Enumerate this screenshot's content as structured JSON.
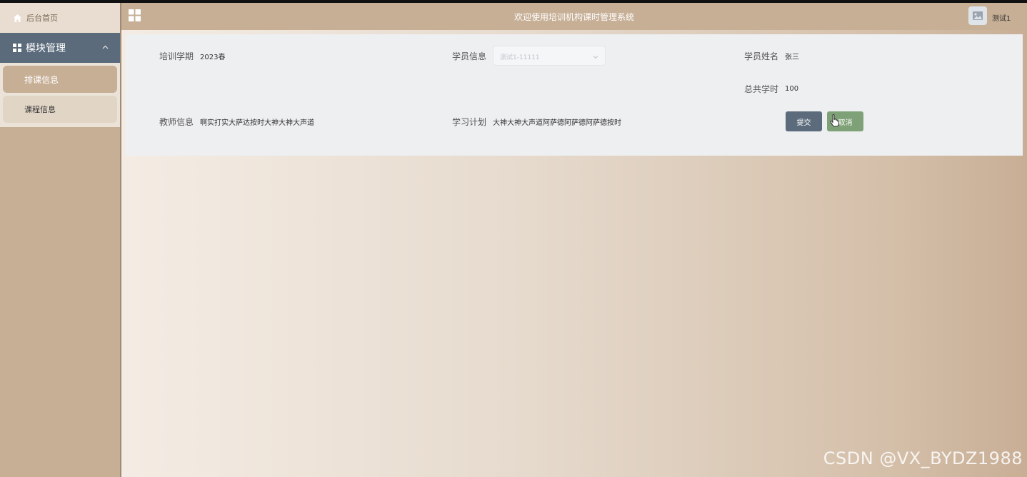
{
  "sidebar": {
    "home_label": "后台首页",
    "section_title": "模块管理",
    "items": [
      {
        "label": "排课信息",
        "active": true
      },
      {
        "label": "课程信息",
        "active": false
      }
    ]
  },
  "header": {
    "title": "欢迎使用培训机构课时管理系统",
    "username": "测试1"
  },
  "form": {
    "term_label": "培训学期",
    "term_value": "2023春",
    "student_info_label": "学员信息",
    "student_info_value": "测试1-11111",
    "student_name_label": "学员姓名",
    "student_name_value": "张三",
    "total_hours_label": "总共学时",
    "total_hours_value": "100",
    "teacher_label": "教师信息",
    "teacher_value": "啊实打实大萨达按时大神大神大声道",
    "plan_label": "学习计划",
    "plan_value": "大神大神大声道阿萨德阿萨德阿萨德按时",
    "submit_label": "提交",
    "cancel_label": "取消"
  },
  "watermark": "CSDN @VX_BYDZ1988",
  "colors": {
    "sidebar_bg": "#c7af96",
    "menu_header_bg": "#5b6b7b",
    "submit_bg": "#5b6b7b",
    "cancel_bg": "#7fa177"
  },
  "icons": {
    "home": "home-icon",
    "module": "grid-icon",
    "menu_toggle": "menu-toggle-icon",
    "avatar": "image-icon",
    "select": "chevron-down-icon",
    "cursor": "hand-cursor-icon"
  }
}
